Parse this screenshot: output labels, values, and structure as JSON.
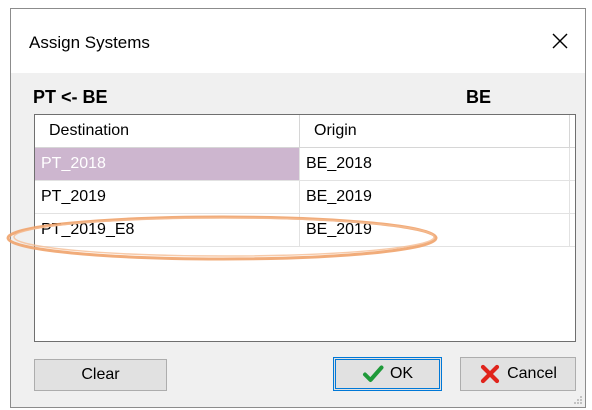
{
  "window": {
    "title": "Assign Systems",
    "close_icon": "close-icon"
  },
  "labels": {
    "left": "PT <- BE",
    "right": "BE"
  },
  "grid": {
    "columns": [
      "Destination",
      "Origin"
    ],
    "rows": [
      {
        "destination": "PT_2018",
        "origin": "BE_2018",
        "selected": true
      },
      {
        "destination": "PT_2019",
        "origin": "BE_2019",
        "selected": false
      },
      {
        "destination": "PT_2019_E8",
        "origin": "BE_2019",
        "selected": false
      }
    ]
  },
  "buttons": {
    "clear": "Clear",
    "ok": "OK",
    "ok_icon": "checkmark-icon",
    "cancel": "Cancel",
    "cancel_icon": "x-icon"
  },
  "colors": {
    "selected_row": "#cdb6cf",
    "annotation": "#f0a36b",
    "ok_check": "#1f9a3a",
    "cancel_x": "#e0241c",
    "focus_border": "#0078d7"
  }
}
